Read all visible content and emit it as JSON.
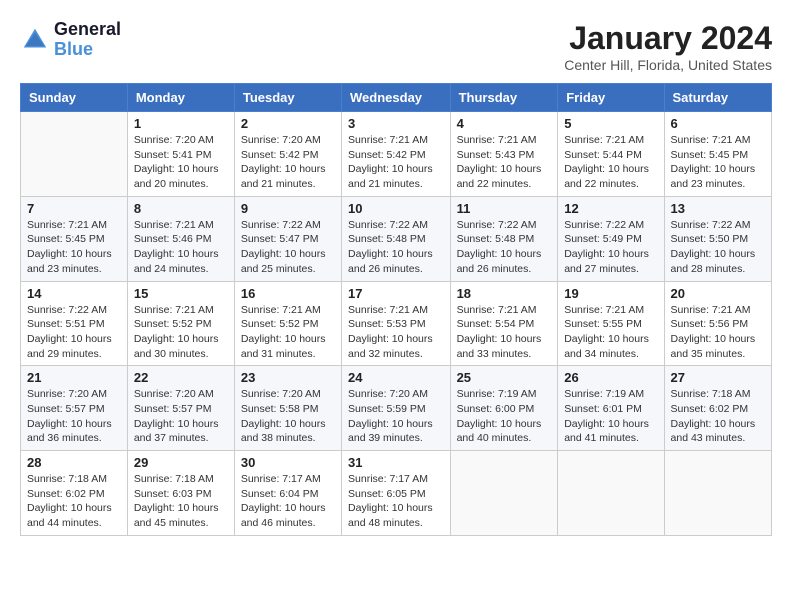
{
  "logo": {
    "line1": "General",
    "line2": "Blue"
  },
  "title": "January 2024",
  "location": "Center Hill, Florida, United States",
  "weekdays": [
    "Sunday",
    "Monday",
    "Tuesday",
    "Wednesday",
    "Thursday",
    "Friday",
    "Saturday"
  ],
  "weeks": [
    [
      {
        "day": "",
        "sunrise": "",
        "sunset": "",
        "daylight": ""
      },
      {
        "day": "1",
        "sunrise": "Sunrise: 7:20 AM",
        "sunset": "Sunset: 5:41 PM",
        "daylight": "Daylight: 10 hours and 20 minutes."
      },
      {
        "day": "2",
        "sunrise": "Sunrise: 7:20 AM",
        "sunset": "Sunset: 5:42 PM",
        "daylight": "Daylight: 10 hours and 21 minutes."
      },
      {
        "day": "3",
        "sunrise": "Sunrise: 7:21 AM",
        "sunset": "Sunset: 5:42 PM",
        "daylight": "Daylight: 10 hours and 21 minutes."
      },
      {
        "day": "4",
        "sunrise": "Sunrise: 7:21 AM",
        "sunset": "Sunset: 5:43 PM",
        "daylight": "Daylight: 10 hours and 22 minutes."
      },
      {
        "day": "5",
        "sunrise": "Sunrise: 7:21 AM",
        "sunset": "Sunset: 5:44 PM",
        "daylight": "Daylight: 10 hours and 22 minutes."
      },
      {
        "day": "6",
        "sunrise": "Sunrise: 7:21 AM",
        "sunset": "Sunset: 5:45 PM",
        "daylight": "Daylight: 10 hours and 23 minutes."
      }
    ],
    [
      {
        "day": "7",
        "sunrise": "Sunrise: 7:21 AM",
        "sunset": "Sunset: 5:45 PM",
        "daylight": "Daylight: 10 hours and 23 minutes."
      },
      {
        "day": "8",
        "sunrise": "Sunrise: 7:21 AM",
        "sunset": "Sunset: 5:46 PM",
        "daylight": "Daylight: 10 hours and 24 minutes."
      },
      {
        "day": "9",
        "sunrise": "Sunrise: 7:22 AM",
        "sunset": "Sunset: 5:47 PM",
        "daylight": "Daylight: 10 hours and 25 minutes."
      },
      {
        "day": "10",
        "sunrise": "Sunrise: 7:22 AM",
        "sunset": "Sunset: 5:48 PM",
        "daylight": "Daylight: 10 hours and 26 minutes."
      },
      {
        "day": "11",
        "sunrise": "Sunrise: 7:22 AM",
        "sunset": "Sunset: 5:48 PM",
        "daylight": "Daylight: 10 hours and 26 minutes."
      },
      {
        "day": "12",
        "sunrise": "Sunrise: 7:22 AM",
        "sunset": "Sunset: 5:49 PM",
        "daylight": "Daylight: 10 hours and 27 minutes."
      },
      {
        "day": "13",
        "sunrise": "Sunrise: 7:22 AM",
        "sunset": "Sunset: 5:50 PM",
        "daylight": "Daylight: 10 hours and 28 minutes."
      }
    ],
    [
      {
        "day": "14",
        "sunrise": "Sunrise: 7:22 AM",
        "sunset": "Sunset: 5:51 PM",
        "daylight": "Daylight: 10 hours and 29 minutes."
      },
      {
        "day": "15",
        "sunrise": "Sunrise: 7:21 AM",
        "sunset": "Sunset: 5:52 PM",
        "daylight": "Daylight: 10 hours and 30 minutes."
      },
      {
        "day": "16",
        "sunrise": "Sunrise: 7:21 AM",
        "sunset": "Sunset: 5:52 PM",
        "daylight": "Daylight: 10 hours and 31 minutes."
      },
      {
        "day": "17",
        "sunrise": "Sunrise: 7:21 AM",
        "sunset": "Sunset: 5:53 PM",
        "daylight": "Daylight: 10 hours and 32 minutes."
      },
      {
        "day": "18",
        "sunrise": "Sunrise: 7:21 AM",
        "sunset": "Sunset: 5:54 PM",
        "daylight": "Daylight: 10 hours and 33 minutes."
      },
      {
        "day": "19",
        "sunrise": "Sunrise: 7:21 AM",
        "sunset": "Sunset: 5:55 PM",
        "daylight": "Daylight: 10 hours and 34 minutes."
      },
      {
        "day": "20",
        "sunrise": "Sunrise: 7:21 AM",
        "sunset": "Sunset: 5:56 PM",
        "daylight": "Daylight: 10 hours and 35 minutes."
      }
    ],
    [
      {
        "day": "21",
        "sunrise": "Sunrise: 7:20 AM",
        "sunset": "Sunset: 5:57 PM",
        "daylight": "Daylight: 10 hours and 36 minutes."
      },
      {
        "day": "22",
        "sunrise": "Sunrise: 7:20 AM",
        "sunset": "Sunset: 5:57 PM",
        "daylight": "Daylight: 10 hours and 37 minutes."
      },
      {
        "day": "23",
        "sunrise": "Sunrise: 7:20 AM",
        "sunset": "Sunset: 5:58 PM",
        "daylight": "Daylight: 10 hours and 38 minutes."
      },
      {
        "day": "24",
        "sunrise": "Sunrise: 7:20 AM",
        "sunset": "Sunset: 5:59 PM",
        "daylight": "Daylight: 10 hours and 39 minutes."
      },
      {
        "day": "25",
        "sunrise": "Sunrise: 7:19 AM",
        "sunset": "Sunset: 6:00 PM",
        "daylight": "Daylight: 10 hours and 40 minutes."
      },
      {
        "day": "26",
        "sunrise": "Sunrise: 7:19 AM",
        "sunset": "Sunset: 6:01 PM",
        "daylight": "Daylight: 10 hours and 41 minutes."
      },
      {
        "day": "27",
        "sunrise": "Sunrise: 7:18 AM",
        "sunset": "Sunset: 6:02 PM",
        "daylight": "Daylight: 10 hours and 43 minutes."
      }
    ],
    [
      {
        "day": "28",
        "sunrise": "Sunrise: 7:18 AM",
        "sunset": "Sunset: 6:02 PM",
        "daylight": "Daylight: 10 hours and 44 minutes."
      },
      {
        "day": "29",
        "sunrise": "Sunrise: 7:18 AM",
        "sunset": "Sunset: 6:03 PM",
        "daylight": "Daylight: 10 hours and 45 minutes."
      },
      {
        "day": "30",
        "sunrise": "Sunrise: 7:17 AM",
        "sunset": "Sunset: 6:04 PM",
        "daylight": "Daylight: 10 hours and 46 minutes."
      },
      {
        "day": "31",
        "sunrise": "Sunrise: 7:17 AM",
        "sunset": "Sunset: 6:05 PM",
        "daylight": "Daylight: 10 hours and 48 minutes."
      },
      {
        "day": "",
        "sunrise": "",
        "sunset": "",
        "daylight": ""
      },
      {
        "day": "",
        "sunrise": "",
        "sunset": "",
        "daylight": ""
      },
      {
        "day": "",
        "sunrise": "",
        "sunset": "",
        "daylight": ""
      }
    ]
  ]
}
